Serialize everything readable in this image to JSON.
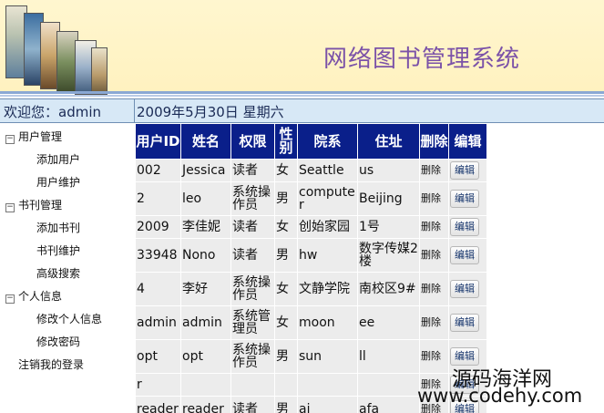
{
  "header": {
    "title": "网络图书管理系统"
  },
  "statusbar": {
    "welcome": "欢迎您：admin",
    "date": "2009年5月30日  星期六"
  },
  "sidebar": {
    "groups": [
      {
        "label": "用户管理",
        "items": [
          "添加用户",
          "用户维护"
        ]
      },
      {
        "label": "书刊管理",
        "items": [
          "添加书刊",
          "书刊维护",
          "高级搜索"
        ]
      },
      {
        "label": "个人信息",
        "items": [
          "修改个人信息",
          "修改密码"
        ]
      }
    ],
    "logout": "注销我的登录"
  },
  "table": {
    "headers": [
      "用户ID",
      "姓名",
      "权限",
      "性别",
      "院系",
      "住址",
      "删除",
      "编辑"
    ],
    "delete_label": "删除",
    "edit_label": "编辑",
    "rows": [
      [
        "002",
        "Jessica",
        "读者",
        "女",
        "Seattle",
        "us"
      ],
      [
        "2",
        "leo",
        "系统操作员",
        "男",
        "computer",
        "Beijing"
      ],
      [
        "2009",
        "李佳妮",
        "读者",
        "女",
        "创始家园",
        "1号"
      ],
      [
        "33948",
        "Nono",
        "读者",
        "男",
        "hw",
        "数字传媒2楼"
      ],
      [
        "4",
        "李好",
        "系统操作员",
        "女",
        "文静学院",
        "南校区9#"
      ],
      [
        "admin",
        "admin",
        "系统管理员",
        "女",
        "moon",
        "ee"
      ],
      [
        "opt",
        "opt",
        "系统操作员",
        "男",
        "sun",
        "ll"
      ],
      [
        "r",
        "",
        "",
        "",
        "",
        ""
      ],
      [
        "reader",
        "reader",
        "读者",
        "男",
        "ai",
        "afa"
      ]
    ]
  },
  "watermark": {
    "line1": "源码海洋网",
    "line2": "www.codehy.com"
  },
  "colors": {
    "header_bg": "#fff2c0",
    "title": "#7b52a8",
    "table_header": "#0a1f8a",
    "row_alt": "#ececec"
  }
}
